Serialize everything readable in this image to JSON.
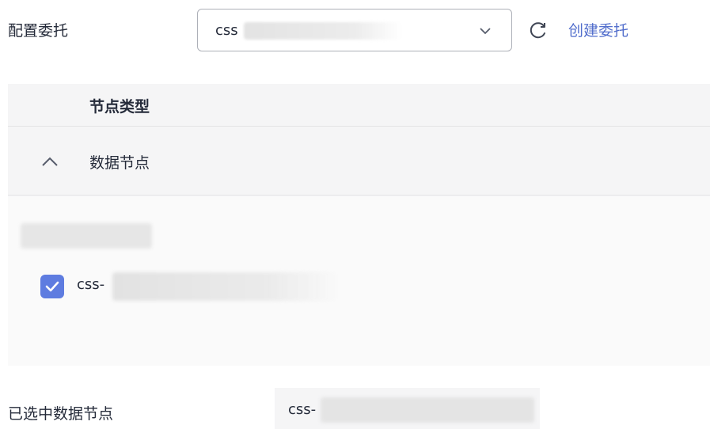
{
  "config": {
    "label": "配置委托",
    "select_value": "css",
    "create_link": "创建委托"
  },
  "table": {
    "header_node_type": "节点类型",
    "group_name": "数据节点",
    "item_prefix": "css-",
    "item_checked": true
  },
  "selected": {
    "label": "已选中数据节点",
    "value_prefix": "css-"
  },
  "colors": {
    "accent": "#5e7ce0",
    "link": "#526ecc"
  },
  "icons": [
    "chevron-down-icon",
    "refresh-icon",
    "chevron-up-icon",
    "check-icon"
  ]
}
